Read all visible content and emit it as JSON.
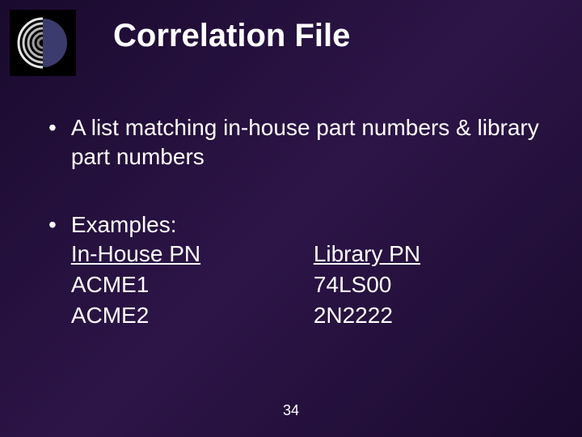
{
  "title": "Correlation File",
  "bullets": {
    "item1": "A list matching in-house part numbers & library part numbers",
    "item2_label": "Examples:"
  },
  "table": {
    "header_left": "In-House PN",
    "header_right": "Library PN",
    "row1_left": "ACME1",
    "row1_right": "74LS00",
    "row2_left": "ACME2",
    "row2_right": "2N2222"
  },
  "page_number": "34"
}
